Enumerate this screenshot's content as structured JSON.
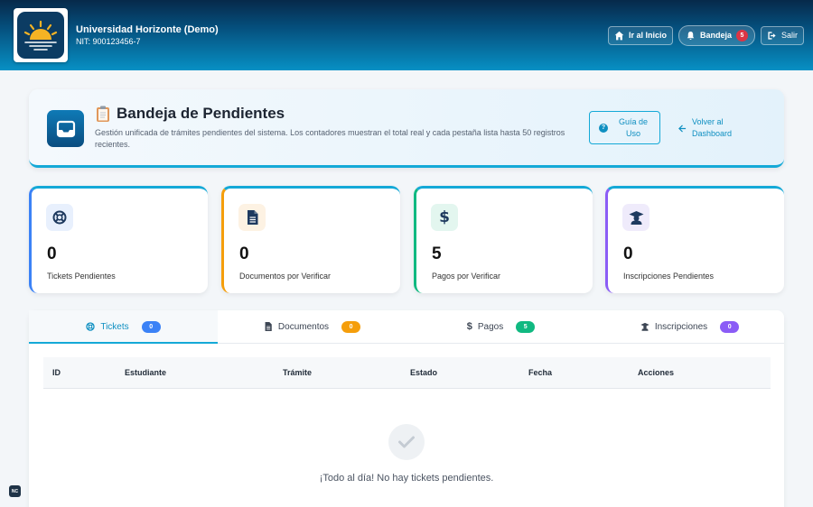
{
  "header": {
    "org_name": "Universidad Horizonte (Demo)",
    "org_nit": "NIT: 900123456-7",
    "home_label": "Ir al Inicio",
    "inbox_label": "Bandeja",
    "inbox_count": "5",
    "logout_label": "Salir",
    "brand_gradient": [
      "#06294a",
      "#0790c4"
    ]
  },
  "page": {
    "title": "Bandeja de Pendientes",
    "subtitle": "Gestión unificada de trámites pendientes del sistema. Los contadores muestran el total real y cada pestaña lista hasta 50 registros recientes.",
    "guide_label": "Guía de Uso",
    "back_label": "Volver al Dashboard"
  },
  "stats": [
    {
      "value": "0",
      "label": "Tickets Pendientes",
      "icon": "lifebuoy-icon",
      "color": "#3b82f6"
    },
    {
      "value": "0",
      "label": "Documentos por Verificar",
      "icon": "file-icon",
      "color": "#f59e0b"
    },
    {
      "value": "5",
      "label": "Pagos por Verificar",
      "icon": "dollar-icon",
      "color": "#10b981"
    },
    {
      "value": "0",
      "label": "Inscripciones Pendientes",
      "icon": "graduate-icon",
      "color": "#8b5cf6"
    }
  ],
  "tabs": [
    {
      "label": "Tickets",
      "count": "0",
      "color": "#3b82f6",
      "active": true
    },
    {
      "label": "Documentos",
      "count": "0",
      "color": "#f59e0b",
      "active": false
    },
    {
      "label": "Pagos",
      "count": "5",
      "color": "#10b981",
      "active": false
    },
    {
      "label": "Inscripciones",
      "count": "0",
      "color": "#8b5cf6",
      "active": false
    }
  ],
  "table": {
    "columns": [
      "ID",
      "Estudiante",
      "Trámite",
      "Estado",
      "Fecha",
      "Acciones"
    ],
    "empty_message": "¡Todo al día! No hay tickets pendientes."
  },
  "footer": {
    "badge": "NC"
  }
}
